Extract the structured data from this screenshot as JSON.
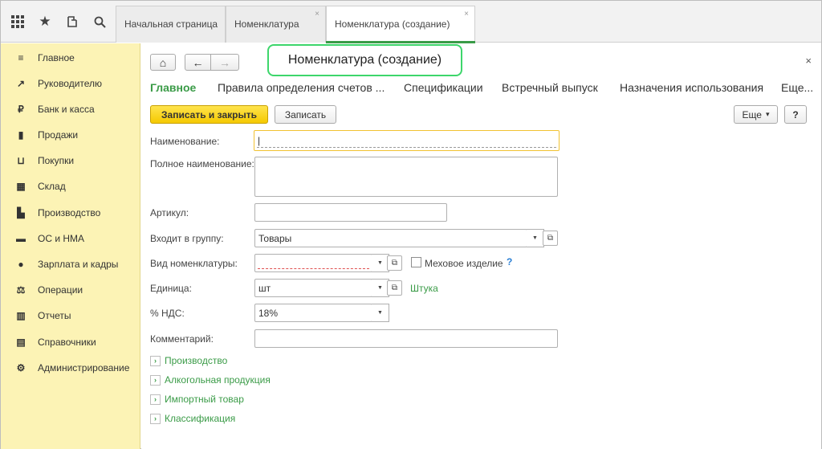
{
  "topbar": {
    "icons": [
      "apps-grid-icon",
      "star-icon",
      "history-icon",
      "search-icon"
    ],
    "tabs": [
      {
        "label": "Начальная страница",
        "close": ""
      },
      {
        "label": "Номенклатура",
        "close": "×"
      },
      {
        "label": "Номенклатура (создание)",
        "close": "×"
      }
    ]
  },
  "sidebar": {
    "items": [
      {
        "label": "Главное",
        "icon": "≡"
      },
      {
        "label": "Руководителю",
        "icon": "↗"
      },
      {
        "label": "Банк и касса",
        "icon": "₽"
      },
      {
        "label": "Продажи",
        "icon": "▮"
      },
      {
        "label": "Покупки",
        "icon": "⊔"
      },
      {
        "label": "Склад",
        "icon": "▦"
      },
      {
        "label": "Производство",
        "icon": "▙"
      },
      {
        "label": "ОС и НМА",
        "icon": "▬"
      },
      {
        "label": "Зарплата и кадры",
        "icon": "●"
      },
      {
        "label": "Операции",
        "icon": "⚖"
      },
      {
        "label": "Отчеты",
        "icon": "▥"
      },
      {
        "label": "Справочники",
        "icon": "▤"
      },
      {
        "label": "Администрирование",
        "icon": "⚙"
      }
    ]
  },
  "form": {
    "title": "Номенклатура (создание)",
    "close": "×",
    "home_icon": "⌂",
    "back_icon": "←",
    "forward_icon": "→",
    "nav_tabs": [
      "Главное",
      "Правила определения счетов ...",
      "Спецификации",
      "Встречный выпуск",
      "Назначения использования",
      "Еще..."
    ],
    "toolbar": {
      "save_close": "Записать и закрыть",
      "save": "Записать",
      "more": "Еще",
      "more_arrow": "▾",
      "help": "?"
    },
    "fields": {
      "name_label": "Наименование:",
      "name_value": "|",
      "full_name_label": "Полное наименование:",
      "full_name_value": "",
      "article_label": "Артикул:",
      "article_value": "",
      "group_label": "Входит в группу:",
      "group_value": "Товары",
      "kind_label": "Вид номенклатуры:",
      "kind_value": "",
      "fur_label": "Меховое изделие",
      "fur_help": "?",
      "unit_label": "Единица:",
      "unit_value": "шт",
      "unit_link": "Штука",
      "vat_label": "% НДС:",
      "vat_value": "18%",
      "comment_label": "Комментарий:",
      "comment_value": ""
    },
    "sections": [
      "Производство",
      "Алкогольная продукция",
      "Импортный товар",
      "Классификация"
    ]
  }
}
